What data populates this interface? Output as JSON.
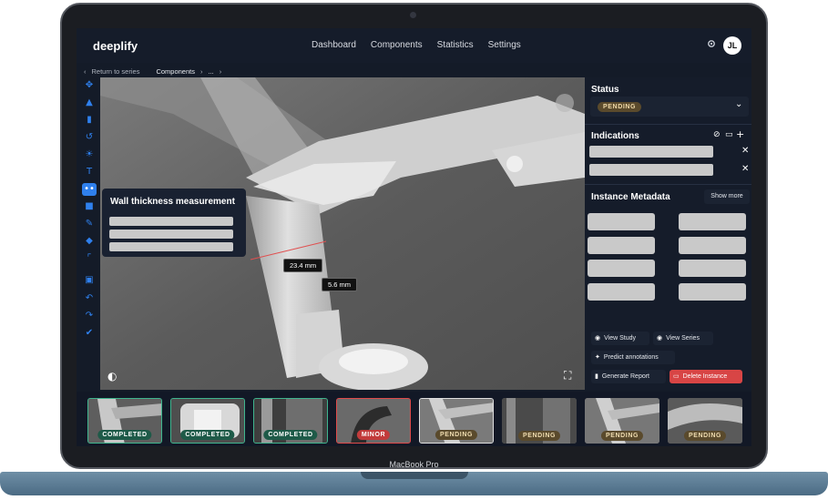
{
  "app": {
    "name": "deeplify"
  },
  "nav": {
    "items": [
      "Dashboard",
      "Components",
      "Statistics",
      "Settings"
    ]
  },
  "user": {
    "initials": "JL"
  },
  "breadcrumb": {
    "back": "Return to series",
    "current": "Components",
    "ellipsis": "..."
  },
  "toolbar": {
    "tools": [
      "move-icon",
      "warning-icon",
      "folder-icon",
      "rotate-icon",
      "brightness-icon",
      "text-tool-icon",
      "measure-tool-icon",
      "ruler-icon",
      "brush-icon",
      "eraser-icon",
      "crop-icon",
      "lock-icon",
      "undo-icon",
      "redo-icon",
      "check-icon"
    ],
    "active": "measure-tool-icon"
  },
  "viewer": {
    "measurement_panel_title": "Wall thickness measurement",
    "measurements": [
      "23.4 mm",
      "5.6 mm"
    ]
  },
  "status": {
    "title": "Status",
    "value": "PENDING"
  },
  "indications": {
    "title": "Indications"
  },
  "metadata": {
    "title": "Instance Metadata",
    "show_more": "Show more"
  },
  "actions": {
    "view_study": "View Study",
    "view_series": "View Series",
    "predict": "Predict annotations",
    "generate_report": "Generate Report",
    "delete": "Delete Instance"
  },
  "filmstrip": [
    {
      "status": "COMPLETED"
    },
    {
      "status": "COMPLETED"
    },
    {
      "status": "COMPLETED"
    },
    {
      "status": "MINOR"
    },
    {
      "status": "PENDING"
    },
    {
      "status": "PENDING"
    },
    {
      "status": "PENDING"
    },
    {
      "status": "PENDING"
    }
  ],
  "device": {
    "label": "MacBook Pro"
  },
  "colors": {
    "accent": "#2f80ed",
    "completed": "#3fb58e",
    "minor": "#e04a4a",
    "pending": "#5a4a2c",
    "delete": "#d84545"
  }
}
